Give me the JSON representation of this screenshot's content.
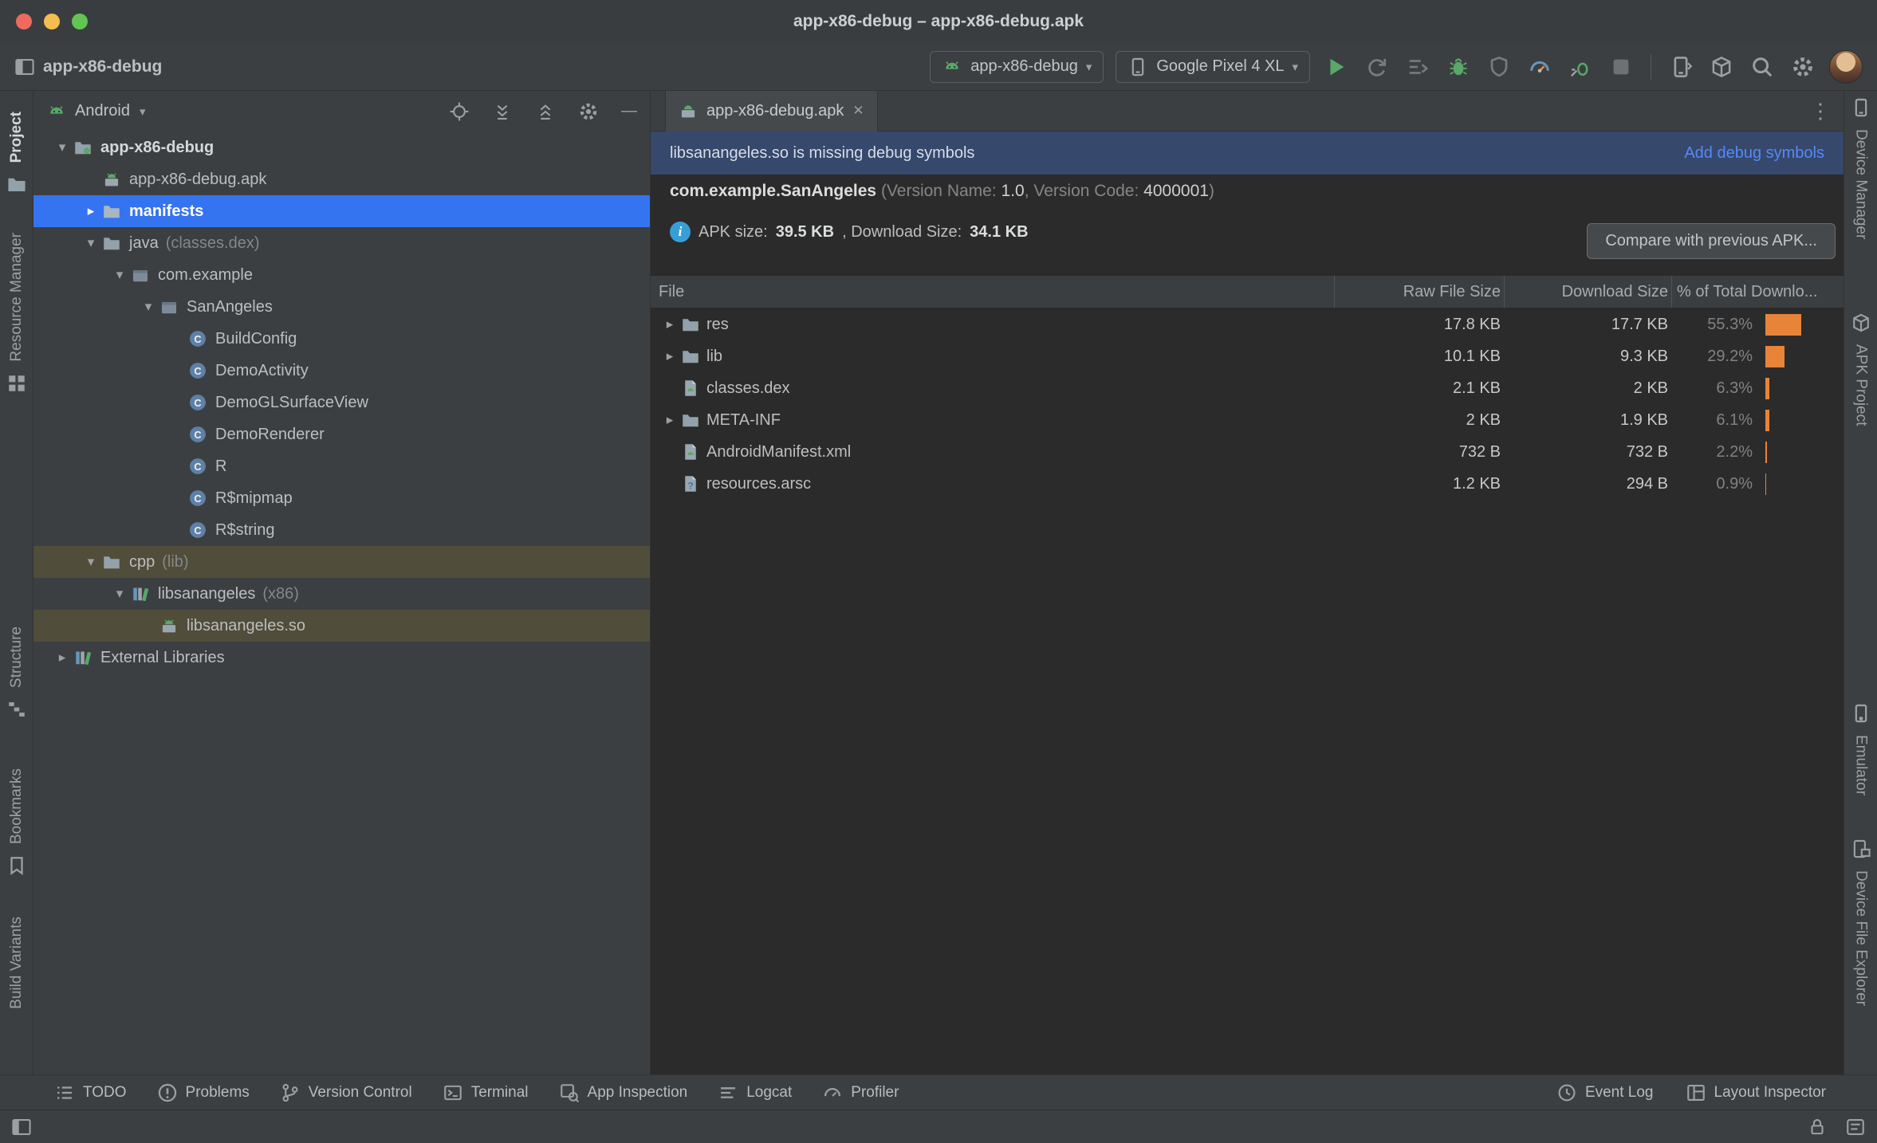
{
  "colors": {
    "panel-bg": "#3C3F41",
    "editor-bg": "#2B2B2B",
    "border": "#323232",
    "selection-blue": "#3574F0",
    "banner-blue": "#36486B",
    "link-blue": "#548AF7",
    "bar-orange": "#E8833A",
    "run-green": "#59A869",
    "olive-row": "#514D3B",
    "info-blue": "#389FD6",
    "text-primary": "#BCBEC0",
    "text-muted": "#84878A"
  },
  "icons": {
    "chevron_down": "▾",
    "chevron_right": "▸",
    "combo_arrow": "▾",
    "close": "✕",
    "more": "⋮",
    "minimize": "—"
  },
  "titlebar": {
    "title": "app-x86-debug – app-x86-debug.apk"
  },
  "toolbar": {
    "project_name": "app-x86-debug",
    "run_config_label": "app-x86-debug",
    "device_label": "Google Pixel 4 XL"
  },
  "left_strip": {
    "project": "Project",
    "resource_manager": "Resource Manager",
    "structure": "Structure",
    "bookmarks": "Bookmarks",
    "build_variants": "Build Variants"
  },
  "right_strip": {
    "device_manager": "Device Manager",
    "apk_project": "APK Project",
    "emulator": "Emulator",
    "device_file_explorer": "Device File Explorer"
  },
  "project_panel": {
    "view_selector": "Android",
    "tree": [
      {
        "label": "app-x86-debug"
      },
      {
        "label": "app-x86-debug.apk"
      },
      {
        "label": "manifests"
      },
      {
        "label": "java",
        "annotation": "(classes.dex)"
      },
      {
        "label": "com.example"
      },
      {
        "label": "SanAngeles"
      },
      {
        "label": "BuildConfig"
      },
      {
        "label": "DemoActivity"
      },
      {
        "label": "DemoGLSurfaceView"
      },
      {
        "label": "DemoRenderer"
      },
      {
        "label": "R"
      },
      {
        "label": "R$mipmap"
      },
      {
        "label": "R$string"
      },
      {
        "label": "cpp",
        "annotation": "(lib)"
      },
      {
        "label": "libsanangeles",
        "annotation": "(x86)"
      },
      {
        "label": "libsanangeles.so"
      },
      {
        "label": "External Libraries"
      }
    ]
  },
  "editor": {
    "tab_title": "app-x86-debug.apk",
    "banner": {
      "message": "libsanangeles.so is missing debug symbols",
      "action": "Add debug symbols"
    },
    "apk_info": {
      "package": "com.example.SanAngeles",
      "v_label1": "(Version Name:",
      "v_name": "1.0",
      "v_sep": ", Version Code:",
      "v_code": "4000001",
      "v_close": ")"
    },
    "size_line": {
      "label1": "APK size:",
      "apk_size": "39.5 KB",
      "label2": ", Download Size:",
      "download_size": "34.1 KB"
    },
    "compare_button": "Compare with previous APK...",
    "table": {
      "columns": {
        "file": "File",
        "raw": "Raw File Size",
        "download": "Download Size",
        "pct": "% of Total Downlo..."
      },
      "rows": [
        {
          "name": "res",
          "raw": "17.8 KB",
          "download": "17.7 KB",
          "pct": "55.3%",
          "pct_value": 55.3
        },
        {
          "name": "lib",
          "raw": "10.1 KB",
          "download": "9.3 KB",
          "pct": "29.2%",
          "pct_value": 29.2
        },
        {
          "name": "classes.dex",
          "raw": "2.1 KB",
          "download": "2 KB",
          "pct": "6.3%",
          "pct_value": 6.3
        },
        {
          "name": "META-INF",
          "raw": "2 KB",
          "download": "1.9 KB",
          "pct": "6.1%",
          "pct_value": 6.1
        },
        {
          "name": "AndroidManifest.xml",
          "raw": "732 B",
          "download": "732 B",
          "pct": "2.2%",
          "pct_value": 2.2
        },
        {
          "name": "resources.arsc",
          "raw": "1.2 KB",
          "download": "294 B",
          "pct": "0.9%",
          "pct_value": 0.9
        }
      ]
    }
  },
  "bottom_bar": {
    "todo": "TODO",
    "problems": "Problems",
    "version_control": "Version Control",
    "terminal": "Terminal",
    "app_inspection": "App Inspection",
    "logcat": "Logcat",
    "profiler": "Profiler",
    "event_log": "Event Log",
    "layout_inspector": "Layout Inspector"
  }
}
